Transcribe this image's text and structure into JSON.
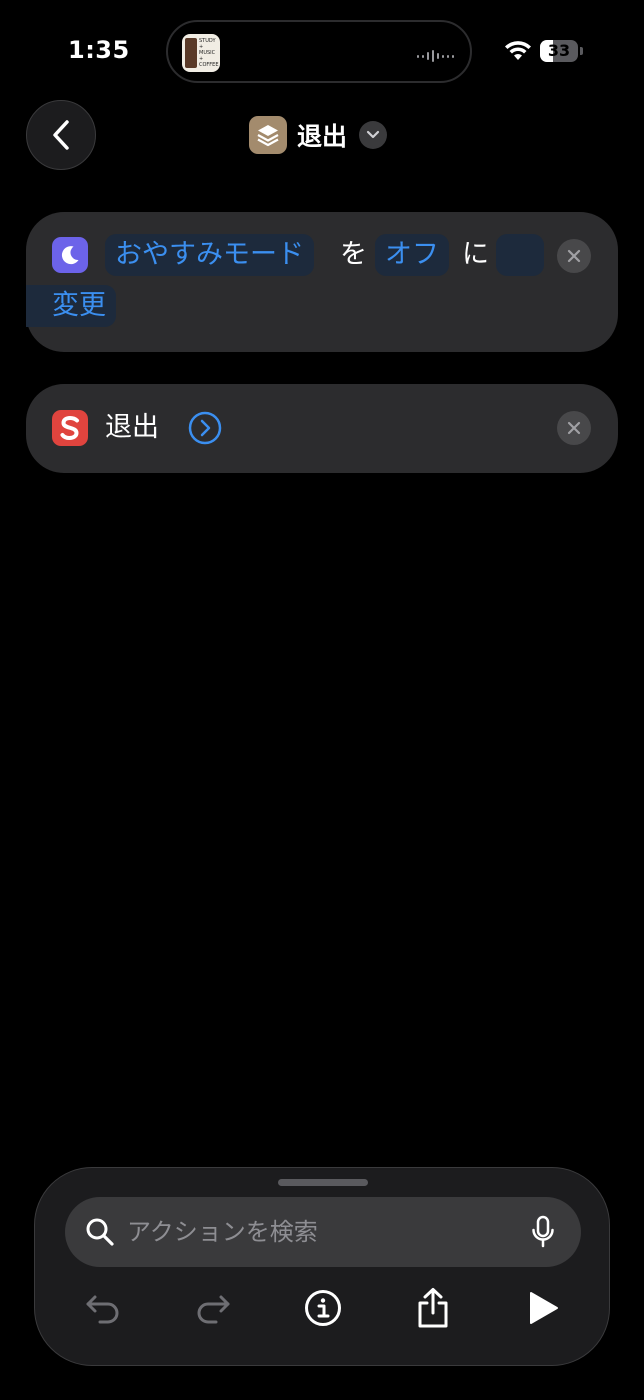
{
  "status_bar": {
    "time": "1:35",
    "battery_percent": "33",
    "battery_level": 0.33,
    "now_playing_art_text": "STUDY\n+\nMUSIC\n+\nCOFFEE"
  },
  "header": {
    "title": "退出",
    "icon": "shortcut-stack-icon",
    "back_icon": "chevron-left-icon",
    "menu_icon": "chevron-down-icon"
  },
  "actions": [
    {
      "app_icon": "moon-icon",
      "app_color": "#6c63e9",
      "tokens": {
        "focus_mode": "おやすみモード",
        "particle_wo": "を",
        "state": "オフ",
        "particle_ni": "に",
        "verb": "変更"
      }
    },
    {
      "app_icon": "s-app-icon",
      "app_color": "#e0443e",
      "label": "退出",
      "expand_icon": "chevron-right-circle-icon"
    }
  ],
  "search": {
    "placeholder": "アクションを検索"
  },
  "toolbar": {
    "undo_icon": "undo-icon",
    "redo_icon": "redo-icon",
    "info_icon": "info-icon",
    "share_icon": "share-icon",
    "play_icon": "play-icon"
  },
  "colors": {
    "background": "#000000",
    "card": "#2c2c2e",
    "accent": "#3b8ff0"
  }
}
